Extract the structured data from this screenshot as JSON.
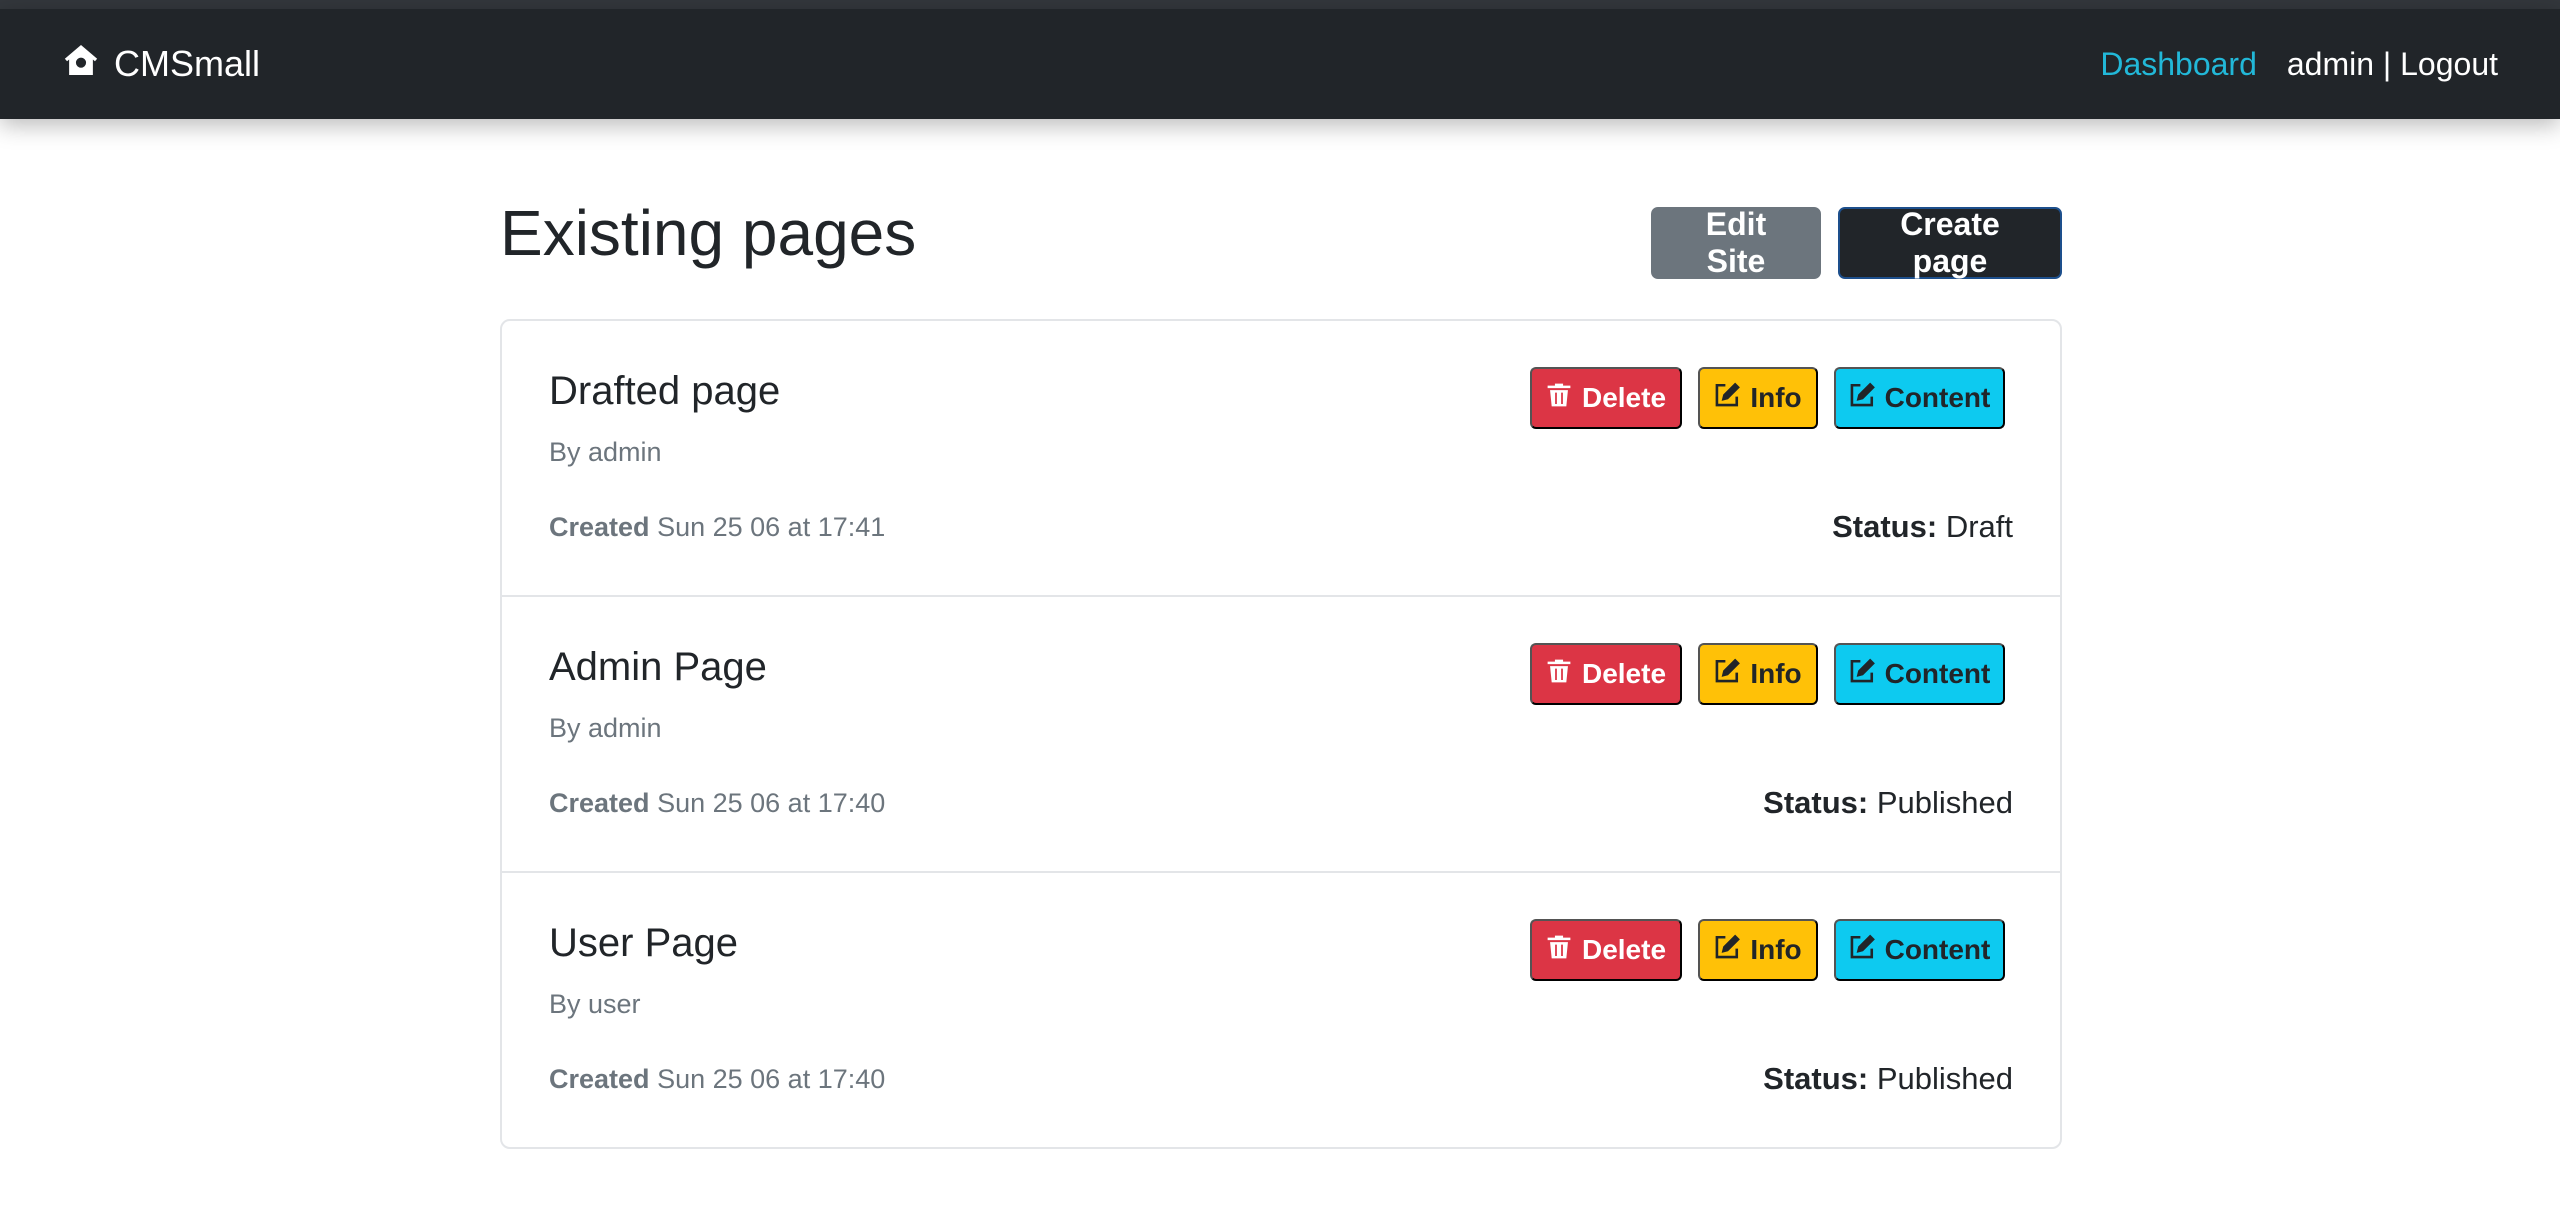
{
  "navbar": {
    "brand": "CMSmall",
    "brand_icon": "house-icon",
    "dashboard_link": "Dashboard",
    "user_logout": "admin | Logout",
    "accent_color": "#22b8d8",
    "background_color": "#212529"
  },
  "header": {
    "title": "Existing pages",
    "edit_site_label": "Edit Site",
    "create_page_label": "Create page"
  },
  "labels": {
    "delete": "Delete",
    "info": "Info",
    "content": "Content",
    "created": "Created",
    "status": "Status:"
  },
  "pages": [
    {
      "title": "Drafted page",
      "author": "By admin",
      "created": "Sun 25 06 at 17:41",
      "status": "Draft"
    },
    {
      "title": "Admin Page",
      "author": "By admin",
      "created": "Sun 25 06 at 17:40",
      "status": "Published"
    },
    {
      "title": "User Page",
      "author": "By user",
      "created": "Sun 25 06 at 17:40",
      "status": "Published"
    }
  ],
  "colors": {
    "danger": "#dc3545",
    "warning": "#ffc107",
    "info": "#0dcaf0",
    "secondary": "#6c757d",
    "dark": "#212529"
  }
}
